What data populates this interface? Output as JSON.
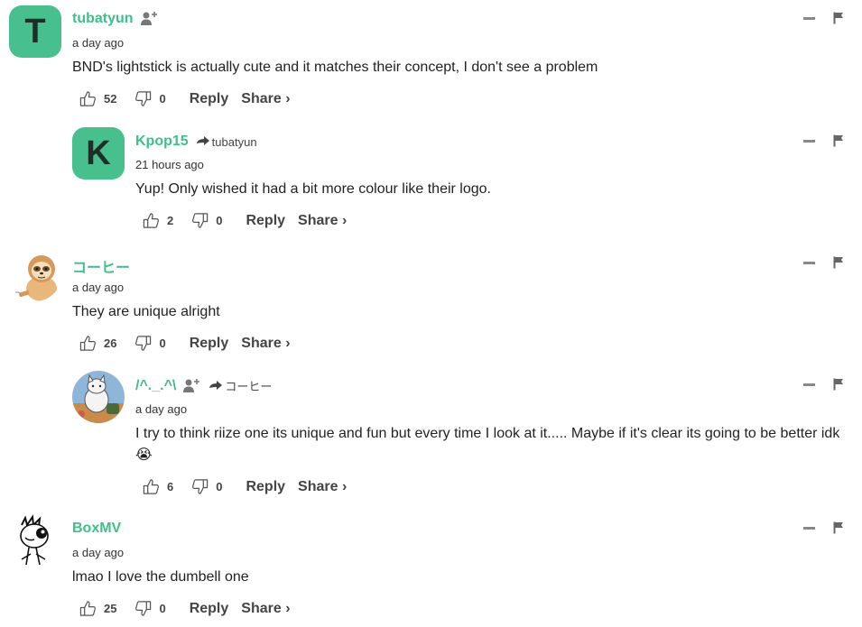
{
  "comments": [
    {
      "username": "tubatyun",
      "avatar_letter": "T",
      "time": "a day ago",
      "text": "BND's lightstick is actually cute and it matches their concept, I don't see a problem",
      "likes": "52",
      "dislikes": "0",
      "reply_label": "Reply",
      "share_label": "Share ›"
    },
    {
      "username": "Kpop15",
      "avatar_letter": "K",
      "reply_to": "tubatyun",
      "time": "21 hours ago",
      "text": "Yup! Only wished it had a bit more colour like their logo.",
      "likes": "2",
      "dislikes": "0",
      "reply_label": "Reply",
      "share_label": "Share ›"
    },
    {
      "username": "コーヒー",
      "avatar_icon": "sloth-avatar",
      "time": "a day ago",
      "text": "They are unique alright",
      "likes": "26",
      "dislikes": "0",
      "reply_label": "Reply",
      "share_label": "Share ›"
    },
    {
      "username": "/^._.^\\",
      "avatar_icon": "cat-avatar",
      "reply_to": "コーヒー",
      "time": "a day ago",
      "text": "I try to think riize one its unique and fun but every time I look at it..... Maybe if it's clear its going to be better idk 😭",
      "likes": "6",
      "dislikes": "0",
      "reply_label": "Reply",
      "share_label": "Share ›"
    },
    {
      "username": "BoxMV",
      "avatar_icon": "meme-face-avatar",
      "time": "a day ago",
      "text": "lmao I love the dumbell one",
      "likes": "25",
      "dislikes": "0",
      "reply_label": "Reply",
      "share_label": "Share ›"
    }
  ],
  "colors": {
    "accent": "#3fbf8a",
    "avatar_bg": "#48c08d"
  }
}
